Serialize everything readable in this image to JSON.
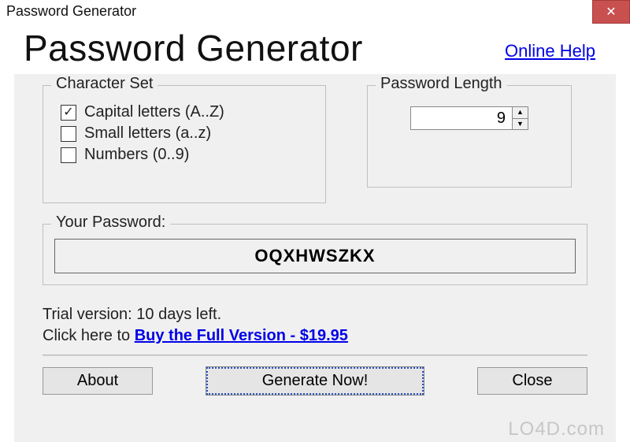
{
  "window": {
    "title": "Password Generator"
  },
  "header": {
    "heading": "Password Generator",
    "online_help": "Online Help"
  },
  "charset": {
    "legend": "Character Set",
    "capital": {
      "label": "Capital letters (A..Z)",
      "checked": true
    },
    "small": {
      "label": "Small letters (a..z)",
      "checked": false
    },
    "numbers": {
      "label": "Numbers (0..9)",
      "checked": false
    }
  },
  "length": {
    "legend": "Password Length",
    "value": "9"
  },
  "password": {
    "legend": "Your Password:",
    "value": "OQXHWSZKX"
  },
  "trial": {
    "line1": "Trial version: 10 days left.",
    "prefix": "Click here to ",
    "buy_link": "Buy the Full Version - $19.95"
  },
  "buttons": {
    "about": "About",
    "generate": "Generate Now!",
    "close": "Close"
  },
  "watermark": "LO4D.com"
}
